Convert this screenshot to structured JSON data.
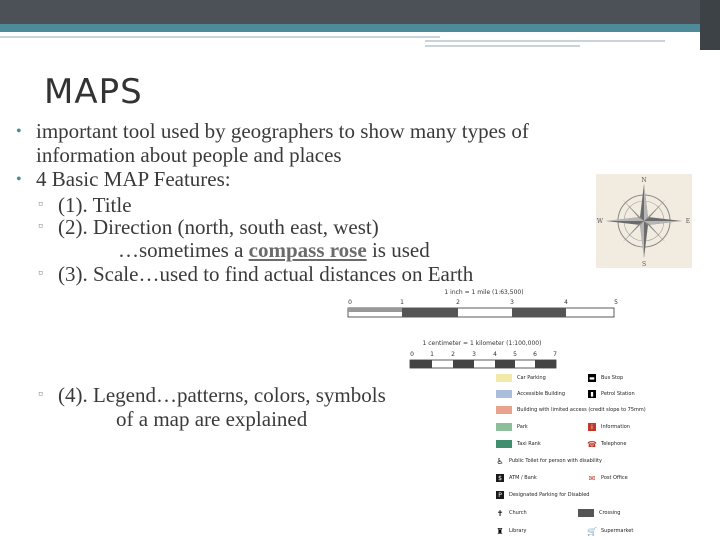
{
  "slide": {
    "title": "MAPS",
    "bullets": [
      {
        "line1": "important tool used by geographers to show many types of",
        "line2": "information about people and places"
      },
      {
        "line1": "4 Basic MAP Features:"
      }
    ],
    "sub_items": {
      "title": "(1).  Title",
      "direction": "(2).  Direction (north, south east, west)",
      "direction_cont_pre": "…sometimes a ",
      "direction_cont_bold": "compass rose",
      "direction_cont_post": " is used",
      "scale": "(3).  Scale…used to find actual distances on Earth",
      "legend_line1": "(4).   Legend…patterns, colors, symbols",
      "legend_line2": "of a map are explained"
    },
    "bullet_glyph": "•",
    "sub_bullet_glyph": "▫"
  },
  "compass": {
    "directions": [
      "N",
      "E",
      "S",
      "W"
    ],
    "color": "#6b6b6b"
  },
  "scale_bars": [
    {
      "caption": "1 inch = 1 mile (1:63,500)",
      "ticks": [
        "0",
        "1",
        "2",
        "3",
        "4",
        "5"
      ]
    },
    {
      "caption": "1 centimeter = 1 kilometer (1:100,000)",
      "ticks": [
        "0",
        "1",
        "2",
        "3",
        "4",
        "5",
        "6",
        "7"
      ]
    }
  ],
  "legend": {
    "items": [
      {
        "label": "Car Parking",
        "icon": "swatch",
        "color": "#f3e9a8"
      },
      {
        "label": "Bus Stop",
        "icon": "bus-icon",
        "color": "#000000"
      },
      {
        "label": "Accessible Building",
        "icon": "swatch",
        "color": "#a9bedd"
      },
      {
        "label": "Petrol Station",
        "icon": "fuel-icon",
        "color": "#000000"
      },
      {
        "label": "Building with limited access (credit slope to 75mm)",
        "icon": "swatch",
        "color": "#e8a28e"
      },
      {
        "label": "Park",
        "icon": "swatch",
        "color": "#8fbf9a"
      },
      {
        "label": "Information",
        "icon": "info-icon",
        "color": "#c0392b"
      },
      {
        "label": "Taxi Rank",
        "icon": "swatch",
        "color": "#3f8f6e"
      },
      {
        "label": "Telephone",
        "icon": "telephone-icon",
        "color": "#c0392b"
      },
      {
        "label": "Public Toilet for person with disability",
        "icon": "wheelchair-icon",
        "color": "#000000"
      },
      {
        "label": "ATM / Bank",
        "icon": "atm-icon",
        "color": "#1a1a1a"
      },
      {
        "label": "Post Office",
        "icon": "post-office-icon",
        "color": "#c0392b"
      },
      {
        "label": "Designated Parking for Disabled",
        "icon": "parking-icon",
        "color": "#1a1a1a"
      },
      {
        "label": "Church",
        "icon": "church-icon",
        "color": "#000000"
      },
      {
        "label": "Crossing",
        "icon": "crossing-icon",
        "color": "#555555"
      },
      {
        "label": "Library",
        "icon": "library-icon",
        "color": "#000000"
      },
      {
        "label": "Supermarket",
        "icon": "supermarket-icon",
        "color": "#c0392b"
      }
    ]
  },
  "colors": {
    "header_dark": "#4b5157",
    "header_accent": "#4e8b99",
    "text": "#3a3a3a"
  }
}
